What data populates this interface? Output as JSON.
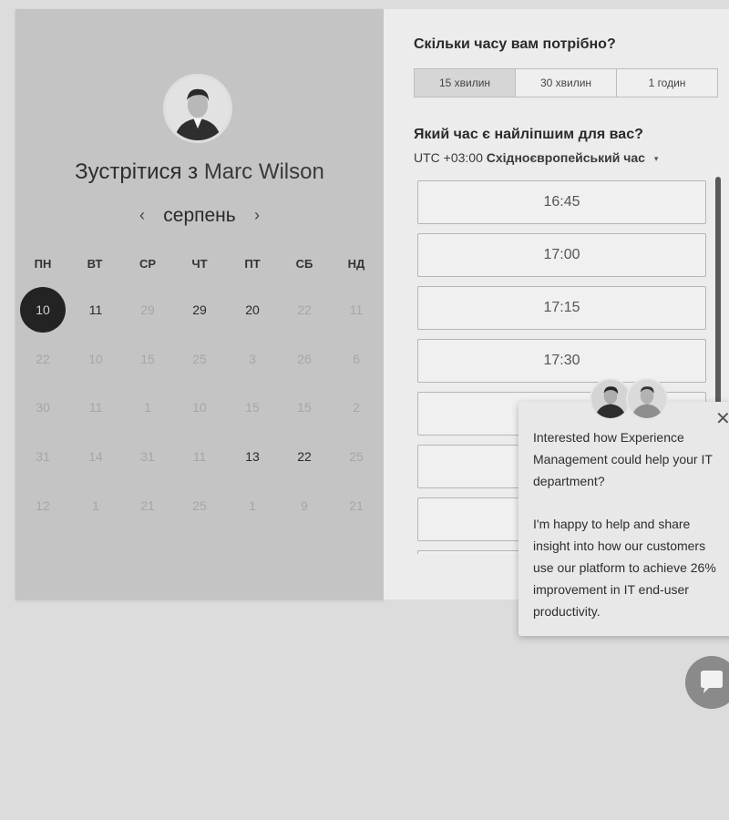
{
  "left": {
    "title_prefix": "Зустрітися з",
    "host_name": "Marc Wilson",
    "month": "серпень",
    "prev_icon": "‹",
    "next_icon": "›",
    "weekdays": [
      "ПН",
      "ВТ",
      "СР",
      "ЧТ",
      "ПТ",
      "СБ",
      "НД"
    ],
    "days": [
      [
        "10",
        "11",
        "29",
        "29",
        "20",
        "22",
        "11"
      ],
      [
        "22",
        "10",
        "15",
        "25",
        "3",
        "26",
        "6"
      ],
      [
        "30",
        "11",
        "1",
        "10",
        "15",
        "15",
        "2"
      ],
      [
        "31",
        "14",
        "31",
        "11",
        "13",
        "22",
        "25"
      ],
      [
        "12",
        "1",
        "21",
        "25",
        "1",
        "9",
        "21"
      ]
    ],
    "active_days": [
      [
        0,
        0
      ],
      [
        0,
        1
      ],
      [
        0,
        3
      ],
      [
        0,
        4
      ],
      [
        3,
        4
      ],
      [
        3,
        5
      ]
    ],
    "selected_day": [
      0,
      0
    ]
  },
  "right": {
    "duration_question": "Скільки часу вам потрібно?",
    "durations": [
      "15 хвилин",
      "30 хвилин",
      "1 годин"
    ],
    "selected_duration": 0,
    "time_question": "Який час є найліпшим для вас?",
    "tz_offset": "UTC +03:00",
    "tz_name": "Східноєвропейський час",
    "tz_caret": "▾",
    "slots": [
      "16:45",
      "17:00",
      "17:15",
      "17:30",
      "",
      "",
      "",
      ""
    ]
  },
  "chat": {
    "close_icon": "✕",
    "message_1": "Interested how Experience Management could help your IT department?",
    "message_2": "I'm happy to help and share insight into how our customers use our platform to achieve 26% improvement in IT end-user productivity."
  },
  "colors": {
    "selected_day_bg": "#232323",
    "left_panel_bg": "#c4c4c4",
    "right_panel_bg": "#ececec"
  }
}
